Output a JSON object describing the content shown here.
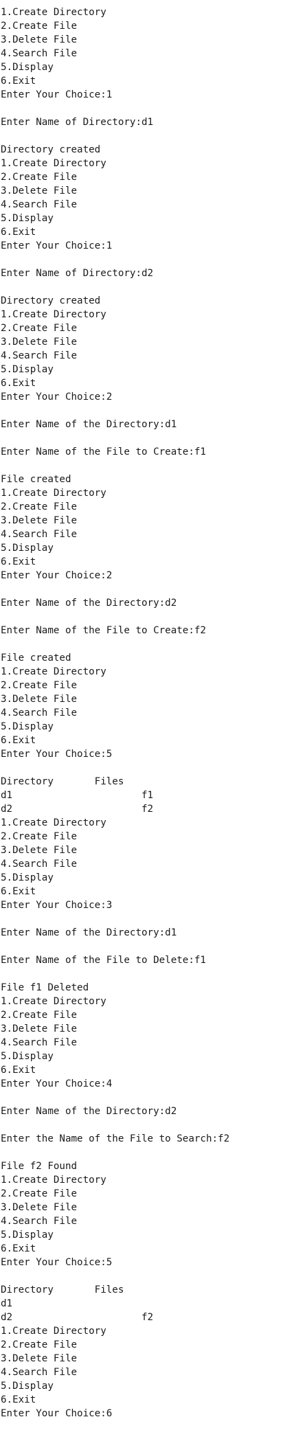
{
  "console": {
    "lines": [
      "1.Create Directory",
      "2.Create File",
      "3.Delete File",
      "4.Search File",
      "5.Display",
      "6.Exit",
      "Enter Your Choice:1",
      "",
      "Enter Name of Directory:d1",
      "",
      "Directory created",
      "1.Create Directory",
      "2.Create File",
      "3.Delete File",
      "4.Search File",
      "5.Display",
      "6.Exit",
      "Enter Your Choice:1",
      "",
      "Enter Name of Directory:d2",
      "",
      "Directory created",
      "1.Create Directory",
      "2.Create File",
      "3.Delete File",
      "4.Search File",
      "5.Display",
      "6.Exit",
      "Enter Your Choice:2",
      "",
      "Enter Name of the Directory:d1",
      "",
      "Enter Name of the File to Create:f1",
      "",
      "File created",
      "1.Create Directory",
      "2.Create File",
      "3.Delete File",
      "4.Search File",
      "5.Display",
      "6.Exit",
      "Enter Your Choice:2",
      "",
      "Enter Name of the Directory:d2",
      "",
      "Enter Name of the File to Create:f2",
      "",
      "File created",
      "1.Create Directory",
      "2.Create File",
      "3.Delete File",
      "4.Search File",
      "5.Display",
      "6.Exit",
      "Enter Your Choice:5",
      "",
      "Directory       Files",
      "d1                      f1",
      "d2                      f2",
      "1.Create Directory",
      "2.Create File",
      "3.Delete File",
      "4.Search File",
      "5.Display",
      "6.Exit",
      "Enter Your Choice:3",
      "",
      "Enter Name of the Directory:d1",
      "",
      "Enter Name of the File to Delete:f1",
      "",
      "File f1 Deleted",
      "1.Create Directory",
      "2.Create File",
      "3.Delete File",
      "4.Search File",
      "5.Display",
      "6.Exit",
      "Enter Your Choice:4",
      "",
      "Enter Name of the Directory:d2",
      "",
      "Enter the Name of the File to Search:f2",
      "",
      "File f2 Found",
      "1.Create Directory",
      "2.Create File",
      "3.Delete File",
      "4.Search File",
      "5.Display",
      "6.Exit",
      "Enter Your Choice:5",
      "",
      "Directory       Files",
      "d1",
      "d2                      f2",
      "1.Create Directory",
      "2.Create File",
      "3.Delete File",
      "4.Search File",
      "5.Display",
      "6.Exit",
      "Enter Your Choice:6"
    ]
  }
}
